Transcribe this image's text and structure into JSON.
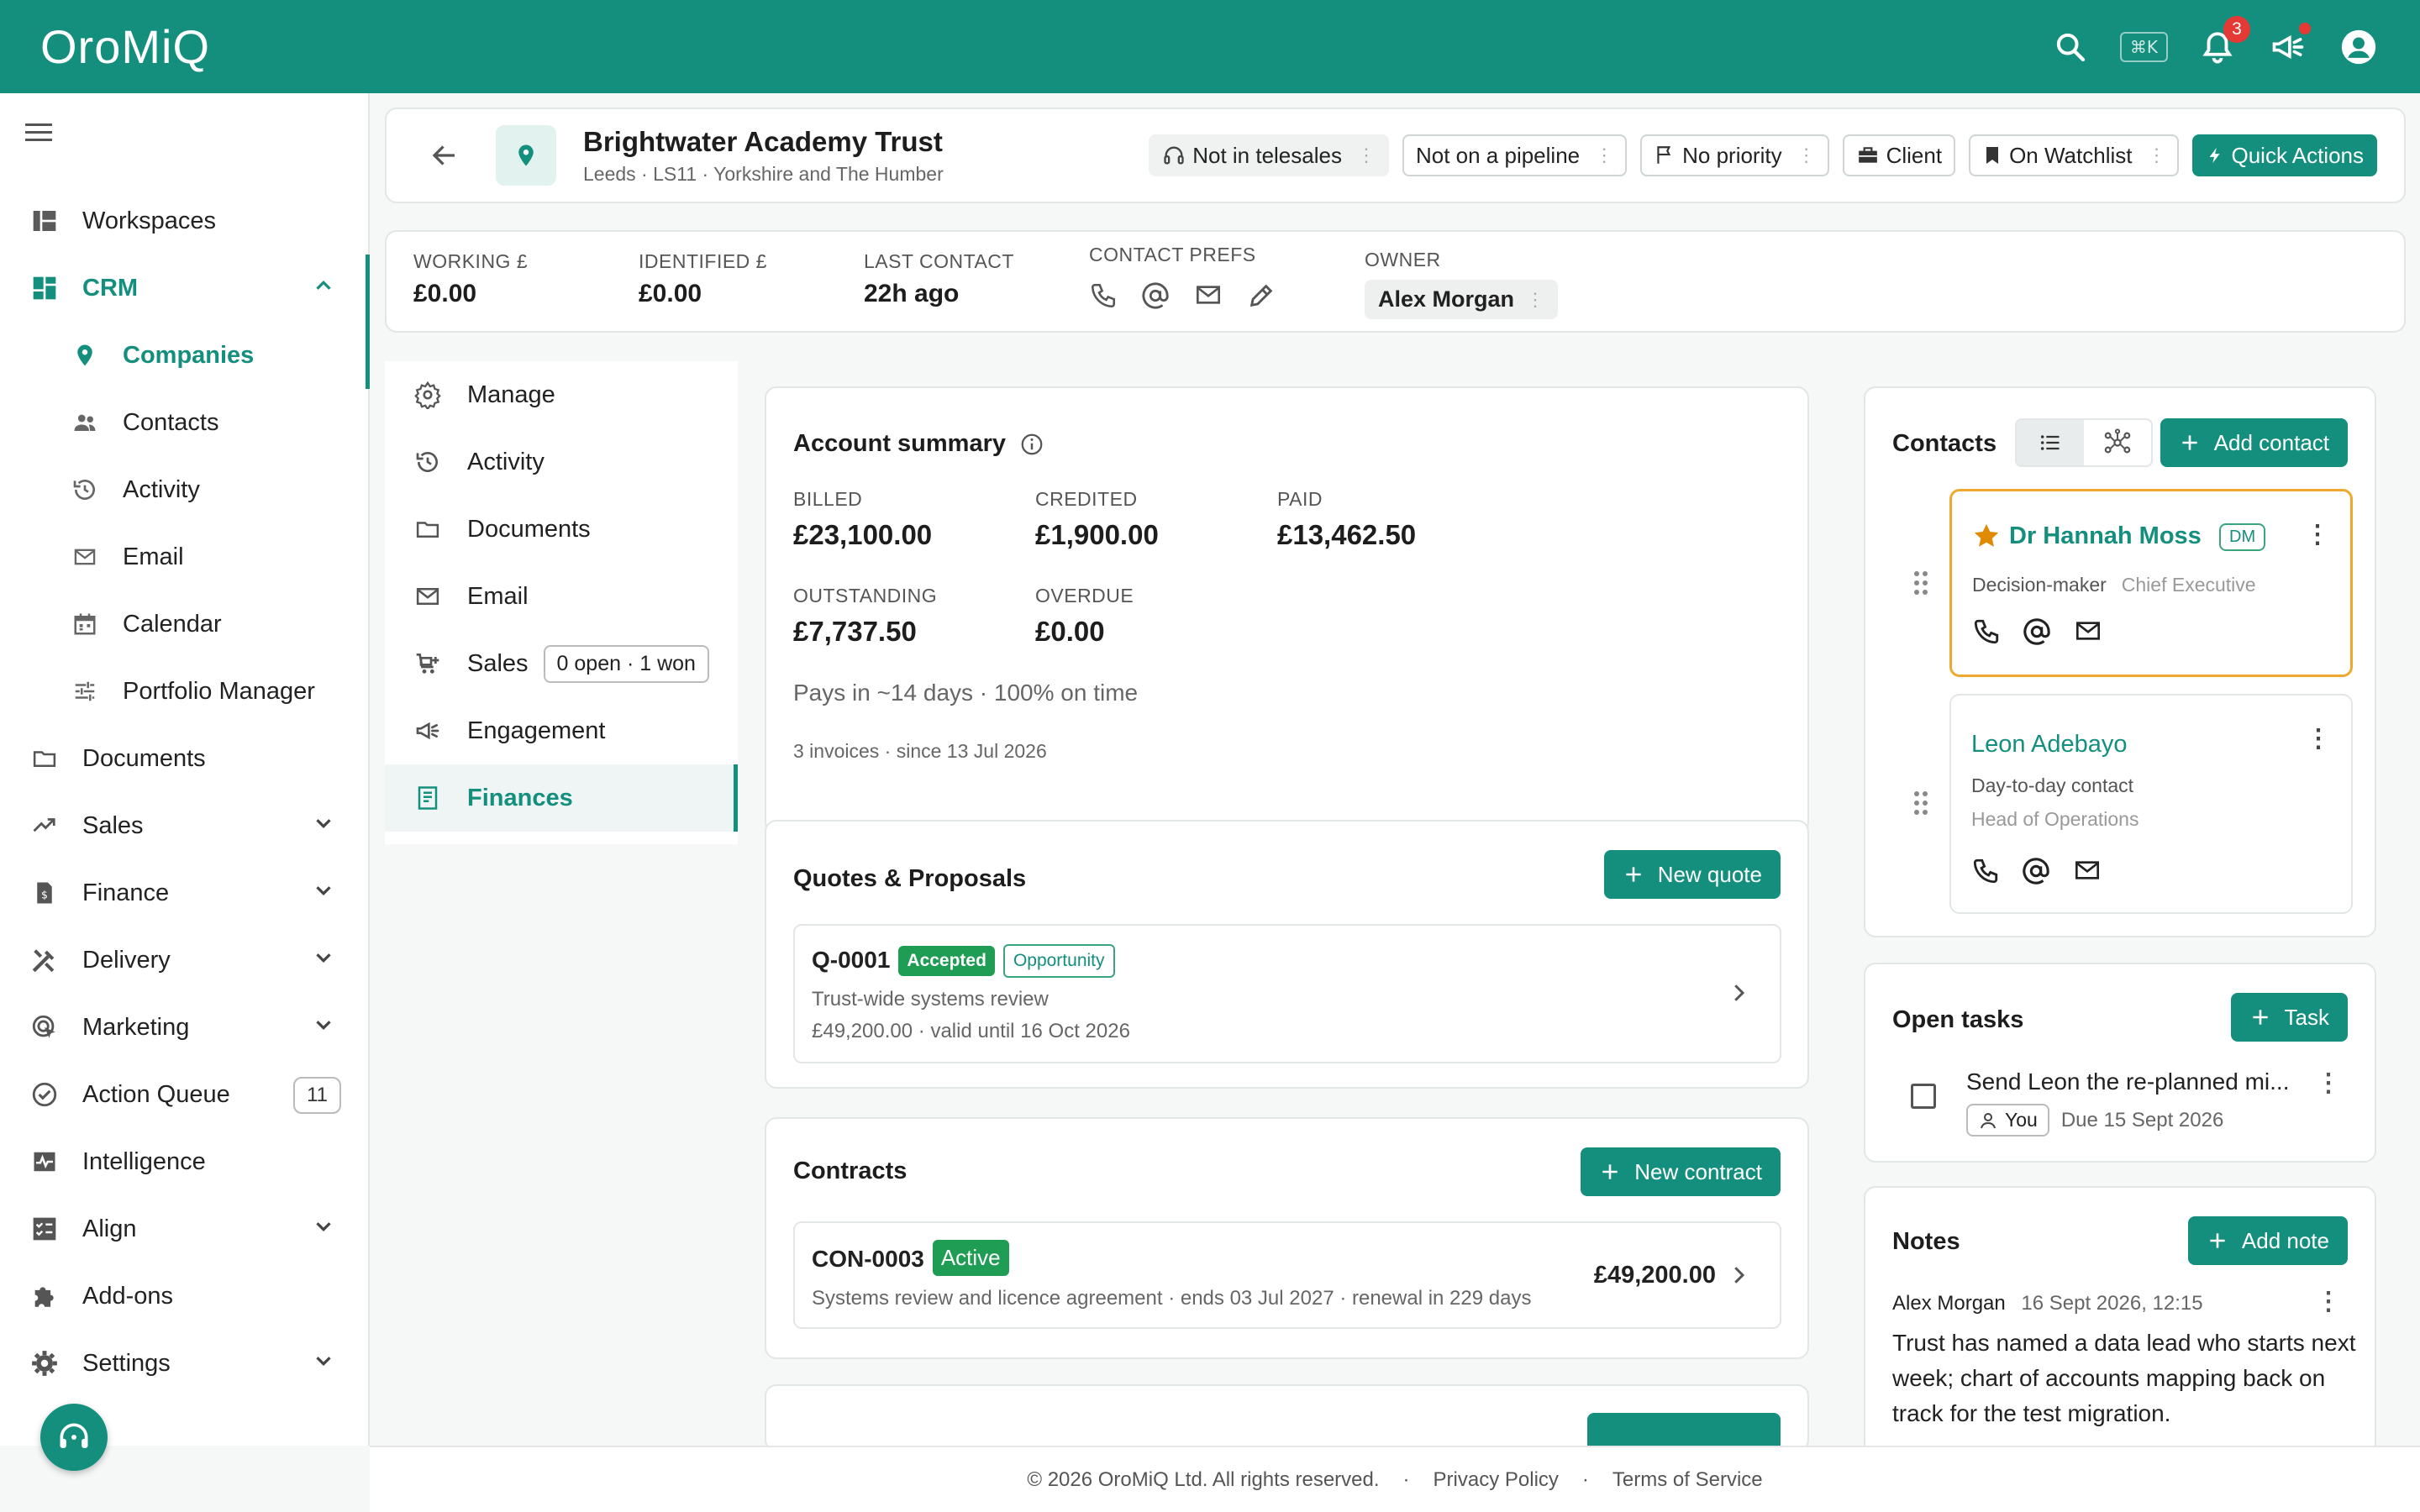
{
  "app": {
    "logo": "OroMiQ",
    "shortcut": "⌘K",
    "notification_count": "3"
  },
  "sidebar": {
    "items": [
      {
        "label": "Workspaces"
      },
      {
        "label": "CRM"
      },
      {
        "label": "Companies"
      },
      {
        "label": "Contacts"
      },
      {
        "label": "Activity"
      },
      {
        "label": "Email"
      },
      {
        "label": "Calendar"
      },
      {
        "label": "Portfolio Manager"
      },
      {
        "label": "Documents"
      },
      {
        "label": "Sales"
      },
      {
        "label": "Finance"
      },
      {
        "label": "Delivery"
      },
      {
        "label": "Marketing"
      },
      {
        "label": "Action Queue",
        "count": "11"
      },
      {
        "label": "Intelligence"
      },
      {
        "label": "Align"
      },
      {
        "label": "Add-ons"
      },
      {
        "label": "Settings"
      }
    ]
  },
  "company": {
    "name": "Brightwater Academy Trust",
    "location": "Leeds · LS11 · Yorkshire and The Humber",
    "pills": {
      "telesales": "Not in telesales",
      "pipeline": "Not on a pipeline",
      "priority": "No priority",
      "client": "Client",
      "watchlist": "On Watchlist",
      "quick_actions": "Quick Actions"
    }
  },
  "stats": {
    "working_label": "WORKING £",
    "working_value": "£0.00",
    "identified_label": "IDENTIFIED £",
    "identified_value": "£0.00",
    "last_contact_label": "LAST CONTACT",
    "last_contact_value": "22h ago",
    "prefs_label": "CONTACT PREFS",
    "owner_label": "OWNER",
    "owner_value": "Alex Morgan"
  },
  "subnav": {
    "manage": "Manage",
    "activity": "Activity",
    "documents": "Documents",
    "email": "Email",
    "sales": "Sales",
    "sales_pill": "0 open · 1 won",
    "engagement": "Engagement",
    "finances": "Finances"
  },
  "account": {
    "title": "Account summary",
    "billed_label": "BILLED",
    "billed": "£23,100.00",
    "credited_label": "CREDITED",
    "credited": "£1,900.00",
    "paid_label": "PAID",
    "paid": "£13,462.50",
    "outstanding_label": "OUTSTANDING",
    "outstanding": "£7,737.50",
    "overdue_label": "OVERDUE",
    "overdue": "£0.00",
    "pays": "Pays in ~14 days · 100% on time",
    "invoices": "3 invoices · since 13 Jul 2026"
  },
  "quotes": {
    "title": "Quotes & Proposals",
    "new_label": "New quote",
    "item": {
      "id": "Q-0001",
      "status": "Accepted",
      "type": "Opportunity",
      "desc": "Trust-wide systems review",
      "meta": "£49,200.00 · valid until 16 Oct 2026"
    }
  },
  "contracts": {
    "title": "Contracts",
    "new_label": "New contract",
    "item": {
      "id": "CON-0003",
      "status": "Active",
      "desc": "Systems review and licence agreement · ends 03 Jul 2027 · renewal in 229 days",
      "amount": "£49,200.00"
    }
  },
  "contacts": {
    "title": "Contacts",
    "add_label": "Add contact",
    "list": [
      {
        "name": "Dr Hannah Moss",
        "badge": "DM",
        "role": "Decision-maker",
        "title": "Chief Executive"
      },
      {
        "name": "Leon Adebayo",
        "role": "Day-to-day contact",
        "title": "Head of Operations"
      }
    ]
  },
  "tasks": {
    "title": "Open tasks",
    "add_label": "Task",
    "item": {
      "text": "Send Leon the re-planned mi...",
      "assignee": "You",
      "due": "Due 15 Sept 2026"
    }
  },
  "notes": {
    "title": "Notes",
    "add_label": "Add note",
    "item": {
      "author": "Alex Morgan",
      "time": "16 Sept 2026, 12:15",
      "text": "Trust has named a data lead who starts next week; chart of accounts mapping back on track for the test migration."
    }
  },
  "footer": {
    "copyright": "© 2026 OroMiQ Ltd. All rights reserved.",
    "sep": "·",
    "privacy": "Privacy Policy",
    "terms": "Terms of Service"
  },
  "colors": {
    "brand": "#148f7e",
    "accent_star": "#e08a00",
    "contact_highlight": "#f0a830"
  }
}
